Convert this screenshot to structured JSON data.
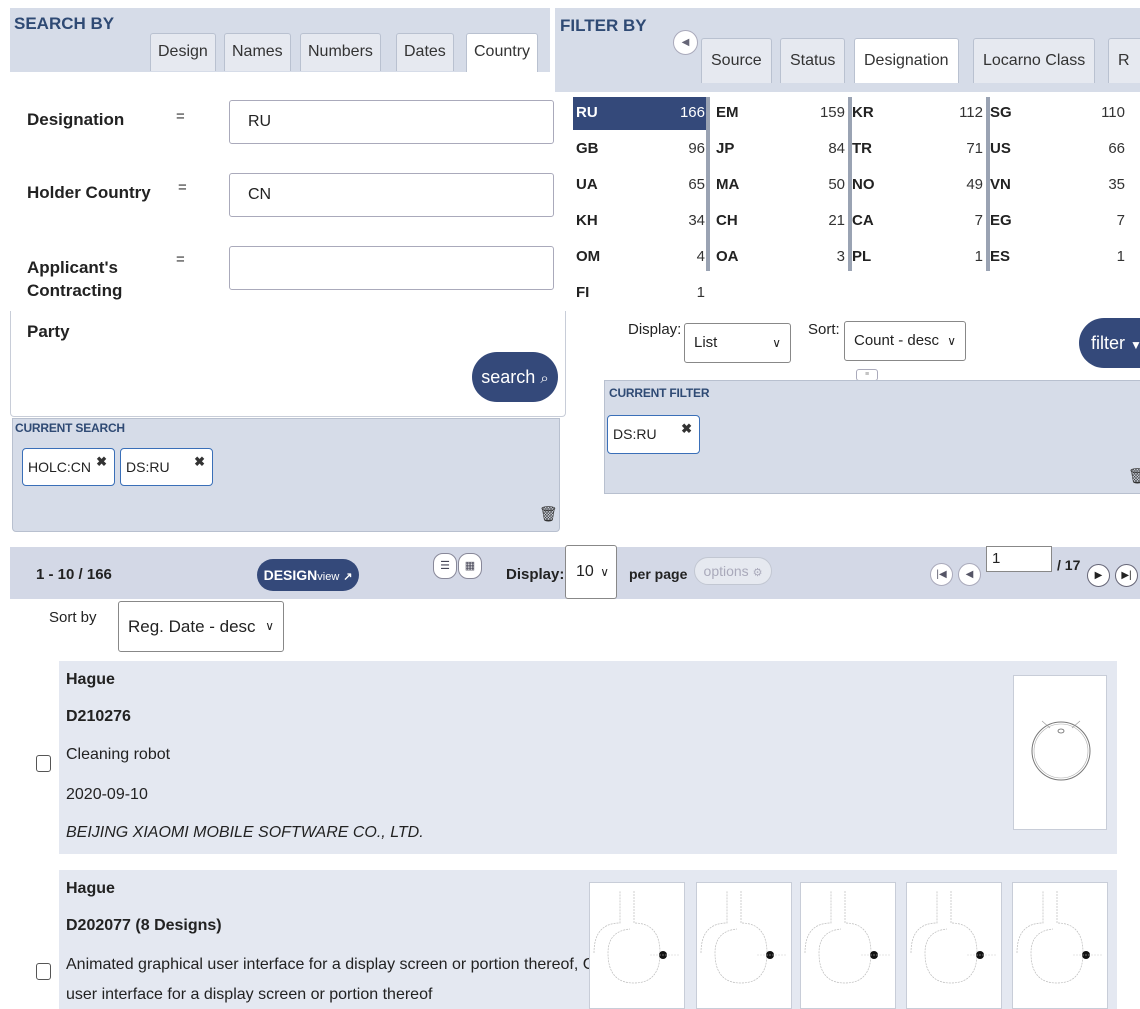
{
  "search_by": {
    "title": "SEARCH BY",
    "tabs": [
      "Design",
      "Names",
      "Numbers",
      "Dates",
      "Country"
    ],
    "active_tab": "Country",
    "fields": [
      {
        "label": "Designation",
        "operator": "=",
        "value": "RU"
      },
      {
        "label": "Holder Country",
        "operator": "=",
        "value": "CN"
      },
      {
        "label": "Applicant's Contracting Party",
        "label_line1": "Applicant's",
        "label_line2": "Contracting",
        "label_line3": "Party",
        "operator": "=",
        "value": ""
      }
    ],
    "search_button": "search",
    "current_search_title": "CURRENT SEARCH",
    "current_search_chips": [
      "HOLC:CN",
      "DS:RU"
    ]
  },
  "filter_by": {
    "title": "FILTER BY",
    "tabs": [
      "Source",
      "Status",
      "Designation",
      "Locarno Class",
      "R"
    ],
    "active_tab": "Designation",
    "countries": [
      {
        "code": "RU",
        "count": "166",
        "selected": true
      },
      {
        "code": "EM",
        "count": "159"
      },
      {
        "code": "KR",
        "count": "112"
      },
      {
        "code": "SG",
        "count": "110"
      },
      {
        "code": "GB",
        "count": "96"
      },
      {
        "code": "JP",
        "count": "84"
      },
      {
        "code": "TR",
        "count": "71"
      },
      {
        "code": "US",
        "count": "66"
      },
      {
        "code": "UA",
        "count": "65"
      },
      {
        "code": "MA",
        "count": "50"
      },
      {
        "code": "NO",
        "count": "49"
      },
      {
        "code": "VN",
        "count": "35"
      },
      {
        "code": "KH",
        "count": "34"
      },
      {
        "code": "CH",
        "count": "21"
      },
      {
        "code": "CA",
        "count": "7"
      },
      {
        "code": "EG",
        "count": "7"
      },
      {
        "code": "OM",
        "count": "4"
      },
      {
        "code": "OA",
        "count": "3"
      },
      {
        "code": "PL",
        "count": "1"
      },
      {
        "code": "ES",
        "count": "1"
      },
      {
        "code": "FI",
        "count": "1"
      }
    ],
    "display_label": "Display:",
    "display_value": "List",
    "sort_label": "Sort:",
    "sort_value": "Count - desc",
    "filter_button": "filter",
    "current_filter_title": "CURRENT FILTER",
    "current_filter_chips": [
      "DS:RU"
    ]
  },
  "results_toolbar": {
    "range": "1 - 10 / 166",
    "designview_main": "DESIGN",
    "designview_sub": "view",
    "display_label": "Display:",
    "per_page_value": "10",
    "per_page_label": "per page",
    "options_label": "options",
    "page_value": "1",
    "page_total": "/ 17"
  },
  "sort": {
    "label": "Sort by",
    "value": "Reg. Date - desc"
  },
  "results": [
    {
      "source": "Hague",
      "number": "D210276",
      "title": "Cleaning robot",
      "date": "2020-09-10",
      "holder": "BEIJING XIAOMI MOBILE SOFTWARE CO., LTD."
    },
    {
      "source": "Hague",
      "number": "D202077 (8 Designs)",
      "title_line1": "Animated graphical user interface for a display screen or portion thereof, Graphical",
      "title_line2": "user interface for a display screen or portion thereof"
    }
  ],
  "colors": {
    "accent": "#34497a",
    "panel": "#d6dce8",
    "card": "#e4e8f1",
    "title": "#2f4a74"
  }
}
